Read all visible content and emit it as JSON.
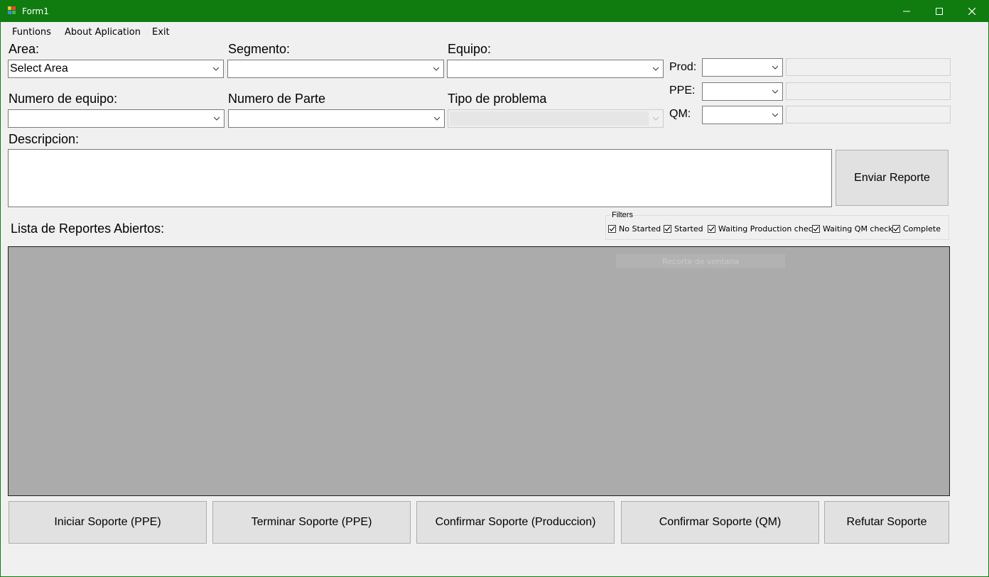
{
  "window": {
    "title": "Form1",
    "titlebar_color": "#107c10"
  },
  "menu": {
    "items": [
      "Funtions",
      "About Aplication",
      "Exit"
    ]
  },
  "labels": {
    "area": "Area:",
    "segmento": "Segmento:",
    "equipo": "Equipo:",
    "numero_equipo": "Numero de equipo:",
    "numero_parte": "Numero de Parte",
    "tipo_problema": "Tipo de problema",
    "descripcion": "Descripcion:",
    "prod": "Prod:",
    "ppe": "PPE:",
    "qm": "QM:",
    "lista": "Lista de Reportes Abiertos:"
  },
  "combos": {
    "area": "Select Area",
    "segmento": "",
    "equipo": "",
    "numero_equipo": "",
    "numero_parte": "",
    "tipo_problema": "",
    "prod": "",
    "ppe": "",
    "qm": ""
  },
  "buttons": {
    "enviar": "Enviar Reporte",
    "iniciar": "Iniciar Soporte (PPE)",
    "terminar": "Terminar Soporte (PPE)",
    "confirmar_prod": "Confirmar Soporte (Produccion)",
    "confirmar_qm": "Confirmar Soporte (QM)",
    "refutar": "Refutar Soporte"
  },
  "filters": {
    "legend": "Filters",
    "options": [
      {
        "label": "No Started",
        "checked": true
      },
      {
        "label": "Started",
        "checked": true
      },
      {
        "label": "Waiting Production check",
        "checked": true
      },
      {
        "label": "Waiting QM check",
        "checked": true
      },
      {
        "label": "Complete",
        "checked": true
      }
    ]
  },
  "ghost_label": "Recorte de ventana"
}
